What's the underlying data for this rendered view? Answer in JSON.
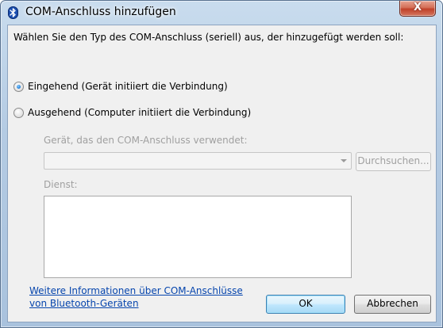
{
  "window": {
    "title": "COM-Anschluss hinzufügen",
    "close_glyph": "X",
    "title_icon": "bluetooth-icon"
  },
  "dialog": {
    "instruction": "Wählen Sie den Typ des COM-Anschluss (seriell) aus, der hinzugefügt werden soll:",
    "radios": [
      {
        "label": "Eingehend (Gerät initiiert die Verbindung)",
        "checked": true
      },
      {
        "label": "Ausgehend (Computer initiiert die Verbindung)",
        "checked": false
      }
    ],
    "device_label": "Gerät, das den COM-Anschluss verwendet:",
    "device_value": "",
    "browse_label": "Durchsuchen...",
    "service_label": "Dienst:",
    "link_line1": "Weitere Informationen über COM-Anschlüsse",
    "link_line2": "von Bluetooth-Geräten",
    "ok_label": "OK",
    "cancel_label": "Abbrechen"
  }
}
